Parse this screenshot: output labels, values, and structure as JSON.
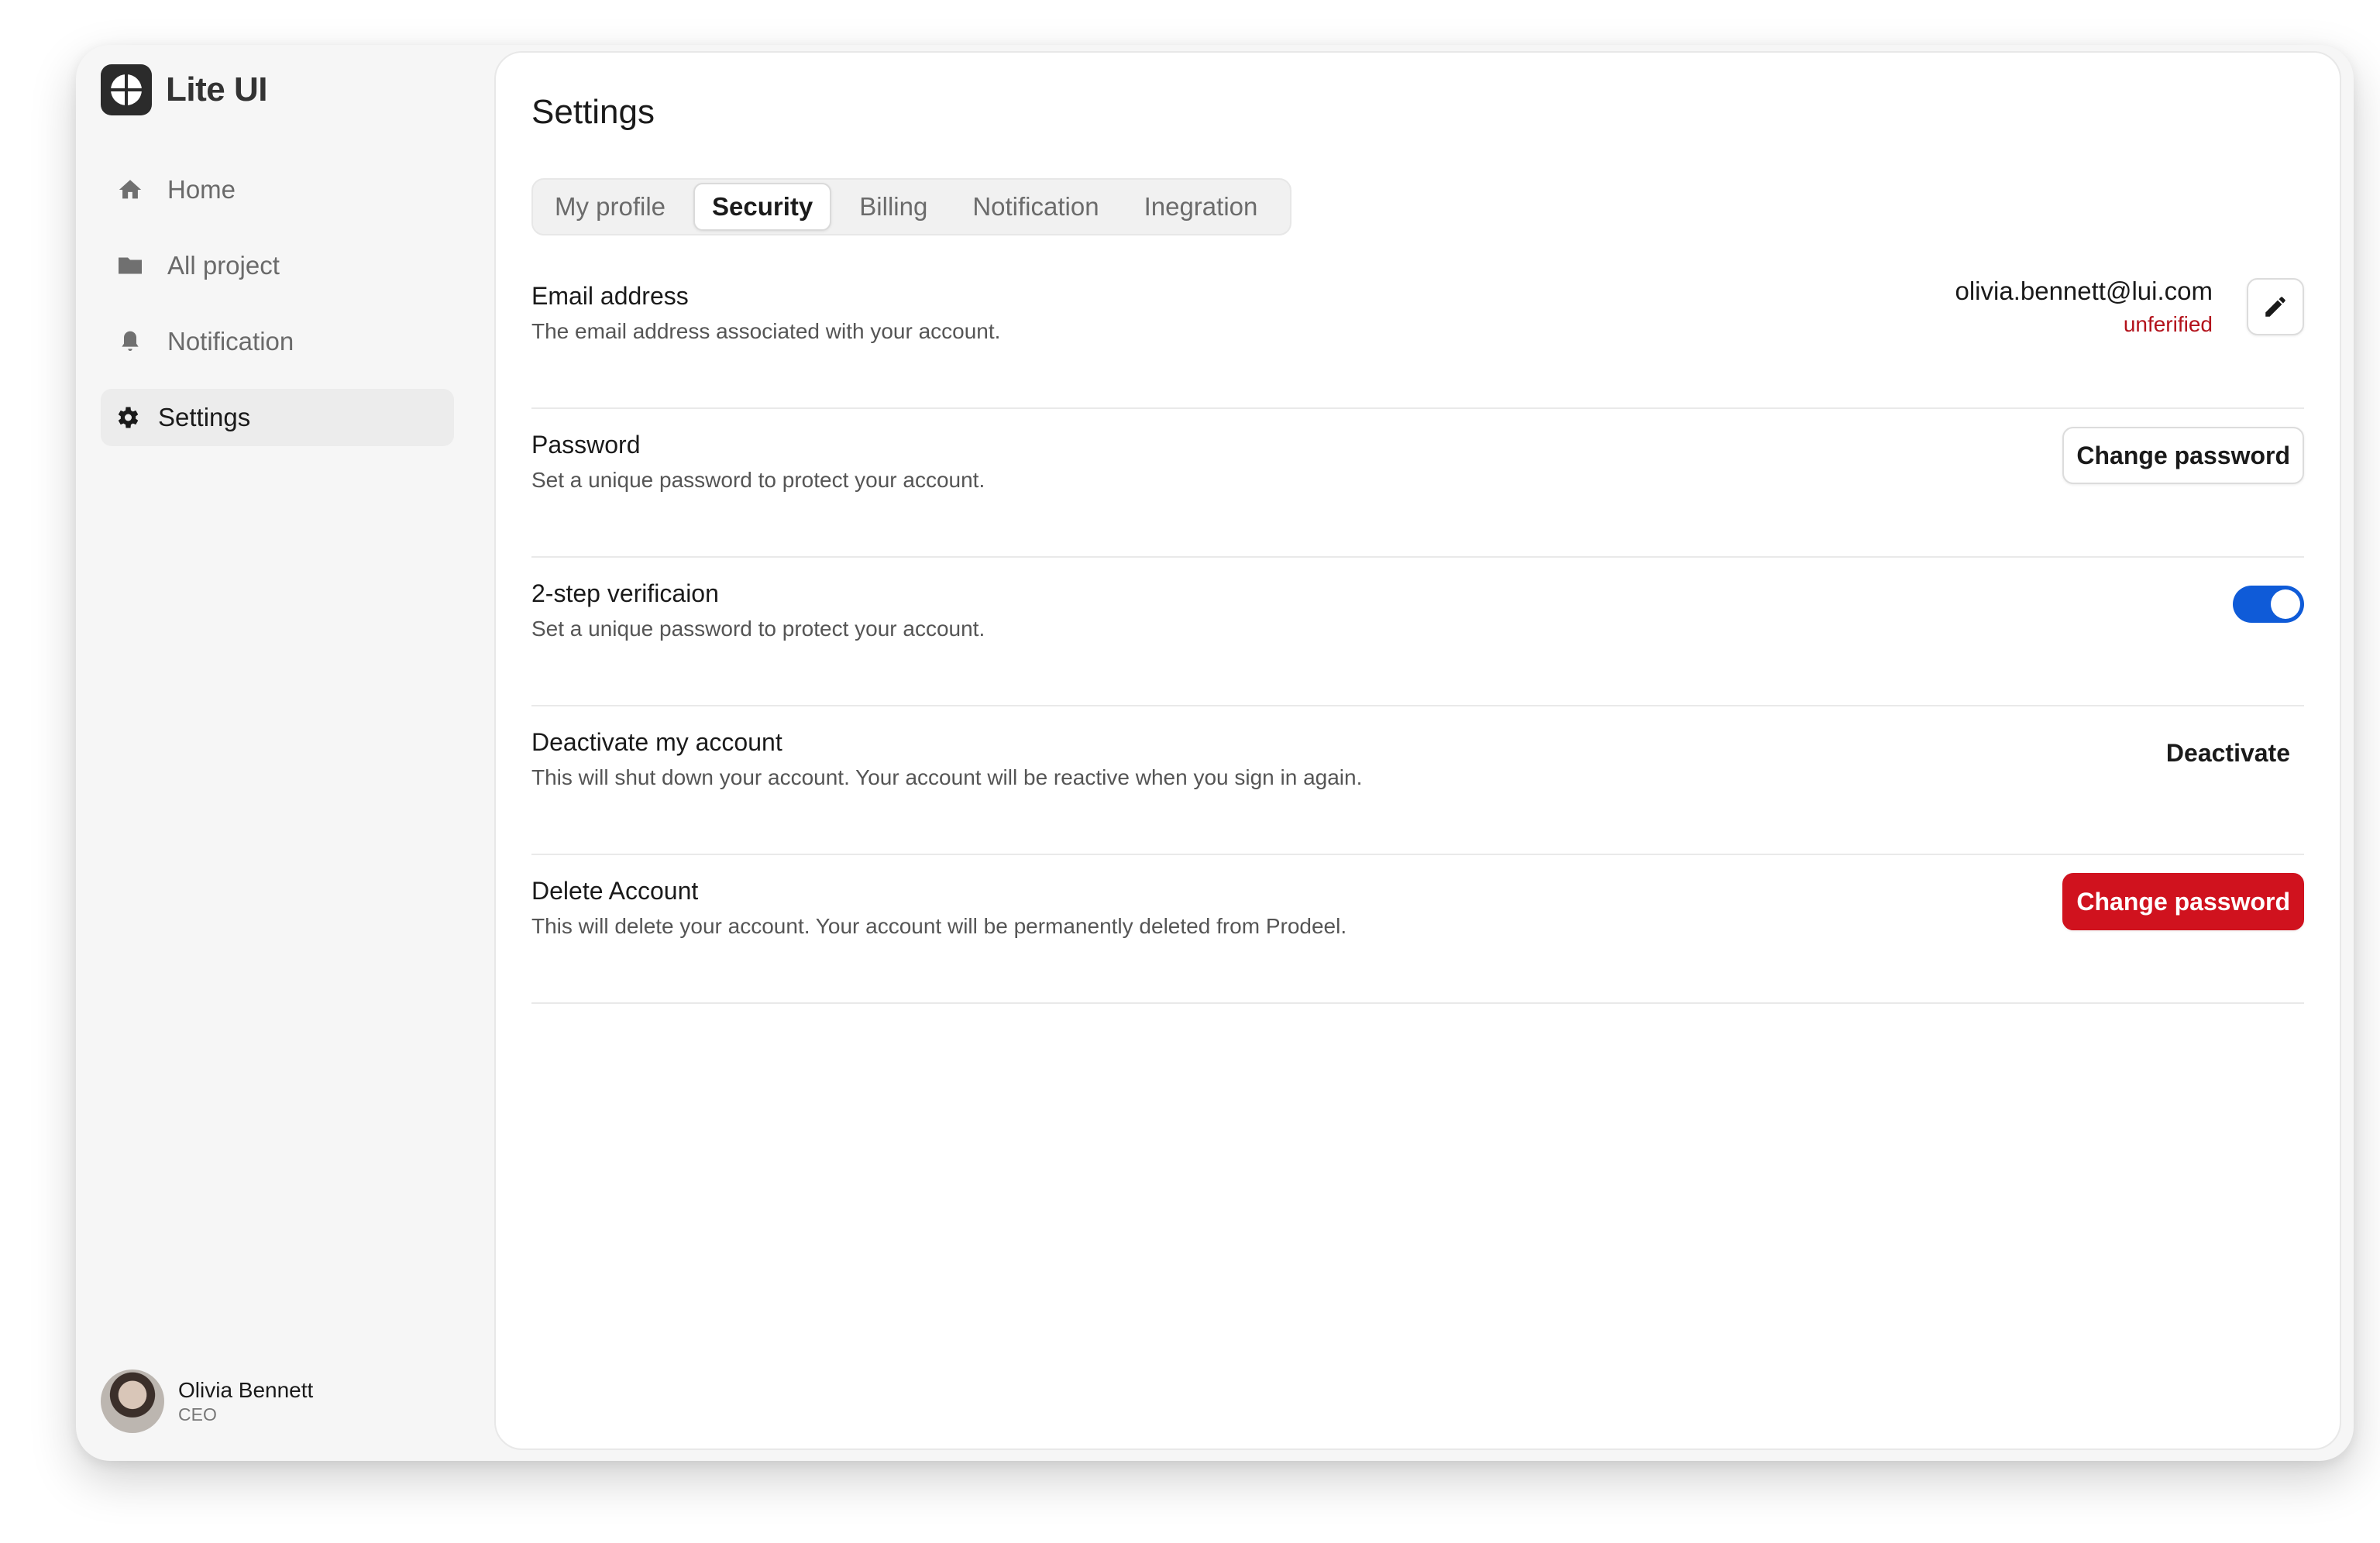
{
  "app": {
    "name": "Lite UI"
  },
  "sidebar": {
    "items": [
      {
        "label": "Home",
        "icon": "home-icon"
      },
      {
        "label": "All project",
        "icon": "folder-icon"
      },
      {
        "label": "Notification",
        "icon": "bell-icon"
      },
      {
        "label": "Settings",
        "icon": "gear-icon",
        "active": true
      }
    ]
  },
  "user": {
    "name": "Olivia Bennett",
    "role": "CEO"
  },
  "main": {
    "title": "Settings",
    "tabs": [
      {
        "label": "My profile"
      },
      {
        "label": "Security",
        "active": true
      },
      {
        "label": "Billing"
      },
      {
        "label": "Notification"
      },
      {
        "label": "Inegration"
      }
    ],
    "rows": {
      "email": {
        "title": "Email address",
        "desc": "The email address associated with your account.",
        "value": "olivia.bennett@lui.com",
        "status": "unferified"
      },
      "password": {
        "title": "Password",
        "desc": "Set a unique password to protect your account.",
        "button": "Change password"
      },
      "twostep": {
        "title": "2-step verificaion",
        "desc": "Set a unique password to protect your account.",
        "enabled": true
      },
      "deactivate": {
        "title": "Deactivate my account",
        "desc": "This will shut down your account. Your account will be reactive when you sign in again.",
        "button": "Deactivate"
      },
      "delete": {
        "title": "Delete Account",
        "desc": "This will delete your account. Your account will be permanently deleted from Prodeel.",
        "button": "Change password"
      }
    }
  },
  "colors": {
    "accent": "#0f5bd8",
    "danger": "#d0121e",
    "warning_text": "#b3121b"
  }
}
